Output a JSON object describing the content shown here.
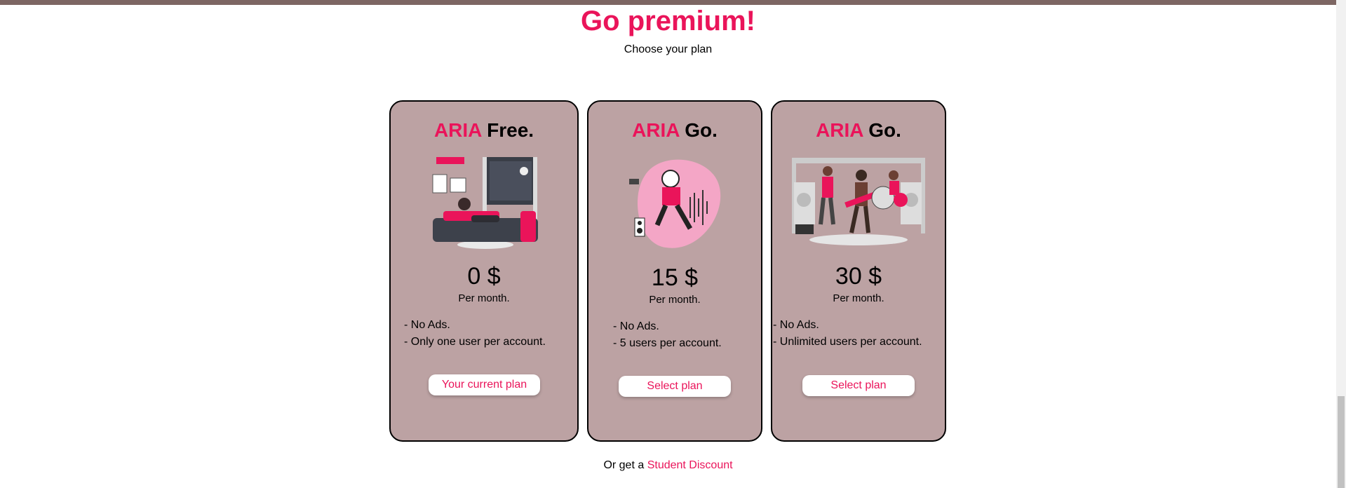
{
  "header": {
    "title": "Go premium!",
    "subtitle": "Choose your plan"
  },
  "plans": [
    {
      "brand": "ARIA",
      "name": "Free.",
      "price": "0 $",
      "period": "Per month.",
      "features": [
        "- No Ads.",
        "- Only one user per account."
      ],
      "button": "Your current plan",
      "illustration": "person-lying-on-bed-illustration"
    },
    {
      "brand": "ARIA",
      "name": "Go.",
      "price": "15 $",
      "period": "Per month.",
      "features": [
        "- No Ads.",
        "- 5 users per account."
      ],
      "button": "Select plan",
      "illustration": "person-listening-music-illustration"
    },
    {
      "brand": "ARIA",
      "name": "Go.",
      "price": "30 $",
      "period": "Per month.",
      "features": [
        "- No Ads.",
        "- Unlimited users per account."
      ],
      "button": "Select plan",
      "illustration": "band-on-stage-illustration"
    }
  ],
  "footer": {
    "prefix": "Or get a",
    "link": "Student Discount"
  },
  "colors": {
    "accent": "#ea145a",
    "card_bg": "#bca2a3",
    "top_bar": "#7d6663"
  }
}
